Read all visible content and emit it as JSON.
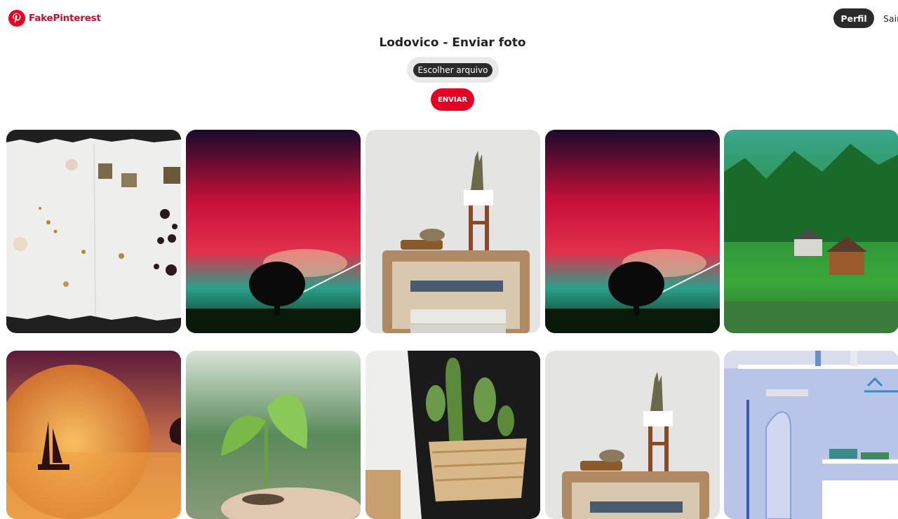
{
  "header": {
    "brand": "FakePinterest",
    "nav": {
      "perfil": "Perfil",
      "sair": "Sair"
    }
  },
  "upload": {
    "title": "Lodovico - Enviar foto",
    "file_button": "Escolher arquivo",
    "submit": "ENVIAR"
  },
  "colors": {
    "brand": "#e60023",
    "dark_button": "#2b2b2b",
    "file_pill": "#e9e9e9"
  },
  "photos": [
    {
      "row": 1,
      "subject": "torn white paper with letter blocks and ink splashes"
    },
    {
      "row": 1,
      "subject": "red nebula sky over silhouette tree"
    },
    {
      "row": 1,
      "subject": "plant on wooden shelf with books"
    },
    {
      "row": 1,
      "subject": "red nebula sky over silhouette tree"
    },
    {
      "row": 1,
      "subject": "green forest with houses by a lake"
    },
    {
      "row": 2,
      "subject": "orange moon with sailboat at sunset"
    },
    {
      "row": 2,
      "subject": "seedling held in hands"
    },
    {
      "row": 2,
      "subject": "cactus in woven basket"
    },
    {
      "row": 2,
      "subject": "plant on wooden shelf with books"
    },
    {
      "row": 2,
      "subject": "blue laundry room with ironing board"
    }
  ]
}
